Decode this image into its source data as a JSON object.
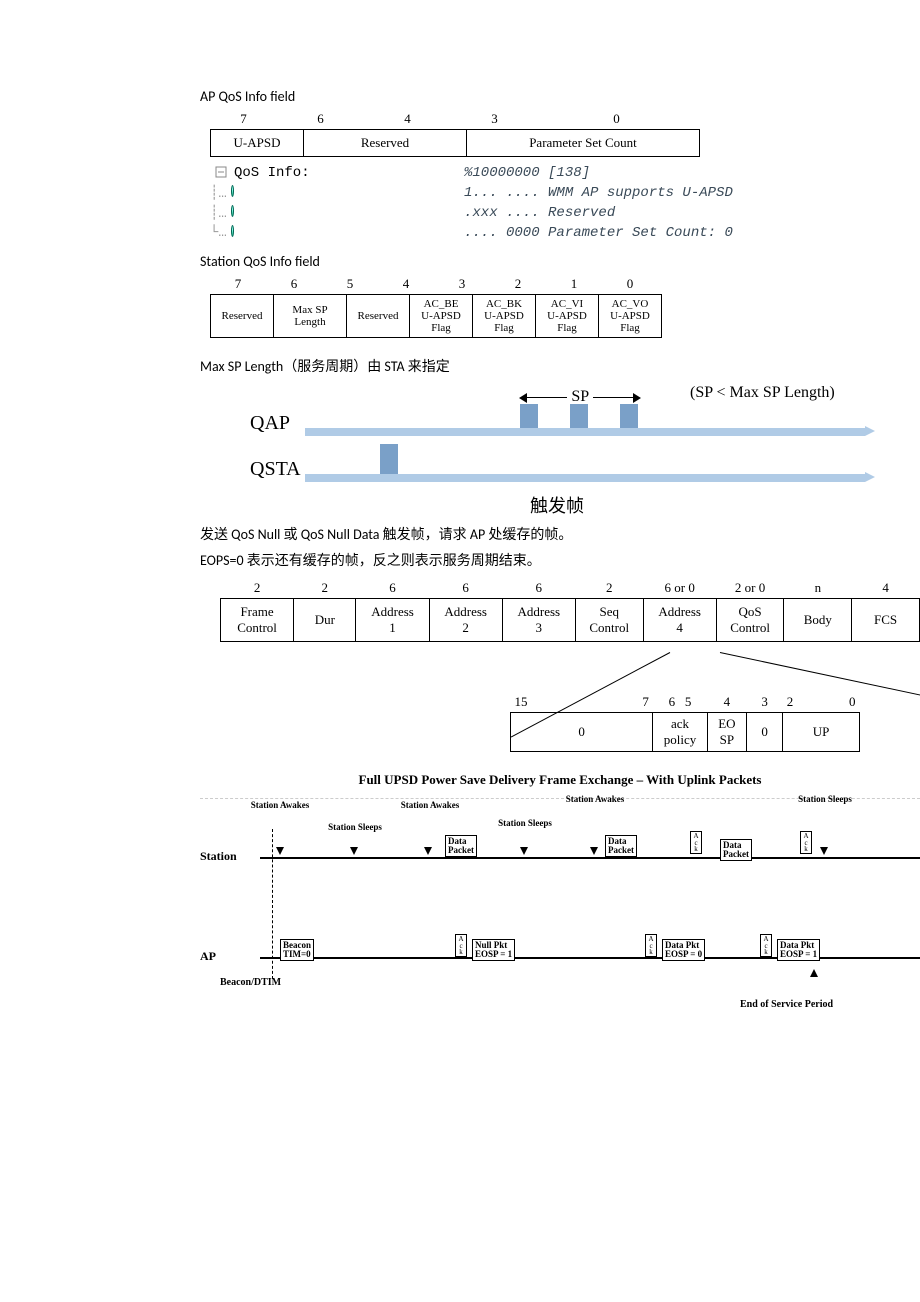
{
  "titles": {
    "ap_qos": "AP QoS Info field",
    "sta_qos": "Station QoS Info field",
    "max_sp": "Max SP Length（服务周期）由 STA 来指定",
    "desc1": "发送 QoS Null 或 QoS Null Data 触发帧，请求 AP 处缓存的帧。",
    "desc2": "EOPS=0 表示还有缓存的帧，反之则表示服务周期结束。"
  },
  "ap_table": {
    "bits": [
      "7",
      "6",
      "4",
      "3",
      "0"
    ],
    "cells": {
      "uapsd": "U-APSD",
      "reserved": "Reserved",
      "psc": "Parameter Set Count"
    }
  },
  "decode": {
    "header_label": "QoS Info:",
    "header_value": "%10000000 [138]",
    "row1": "1... .... WMM AP supports U-APSD",
    "row2": ".xxx .... Reserved",
    "row3": ".... 0000 Parameter Set Count: 0"
  },
  "sta_table": {
    "bits": [
      "7",
      "6",
      "5",
      "4",
      "3",
      "2",
      "1",
      "0"
    ],
    "cells": [
      "Reserved",
      "Max SP\nLength",
      "Reserved",
      "AC_BE\nU-APSD\nFlag",
      "AC_BK\nU-APSD\nFlag",
      "AC_VI\nU-APSD\nFlag",
      "AC_VO\nU-APSD\nFlag"
    ]
  },
  "sp_diagram": {
    "qap": "QAP",
    "qsta": "QSTA",
    "sp": "SP",
    "note": "(SP < Max SP Length)",
    "trigger": "触发帧"
  },
  "mac": {
    "sizes": [
      "2",
      "2",
      "6",
      "6",
      "6",
      "2",
      "6 or 0",
      "2 or 0",
      "n",
      "4"
    ],
    "fields": [
      "Frame\nControl",
      "Dur",
      "Address\n1",
      "Address\n2",
      "Address\n3",
      "Seq\nControl",
      "Address\n4",
      "QoS\nControl",
      "Body",
      "FCS"
    ]
  },
  "qos_ctrl": {
    "bits": [
      "15",
      "7",
      "6   5",
      "4",
      "3",
      "2",
      "0"
    ],
    "fields": [
      "0",
      "ack\npolicy",
      "EO\nSP",
      "0",
      "UP"
    ]
  },
  "upsd": {
    "title": "Full UPSD Power Save Delivery Frame Exchange – With Uplink Packets",
    "station": "Station",
    "ap": "AP",
    "beacon_dtim": "Beacon/DTIM",
    "awakes": "Station Awakes",
    "sleeps": "Station Sleeps",
    "data_packet": "Data\nPacket",
    "ack_vert": "A\nc\nk",
    "beacon": "Beacon\nTIM=0",
    "nullpkt": "Null Pkt\nEOSP = 1",
    "datapkt0": "Data Pkt\nEOSP = 0",
    "datapkt1": "Data Pkt\nEOSP = 1",
    "end": "End of Service Period"
  }
}
